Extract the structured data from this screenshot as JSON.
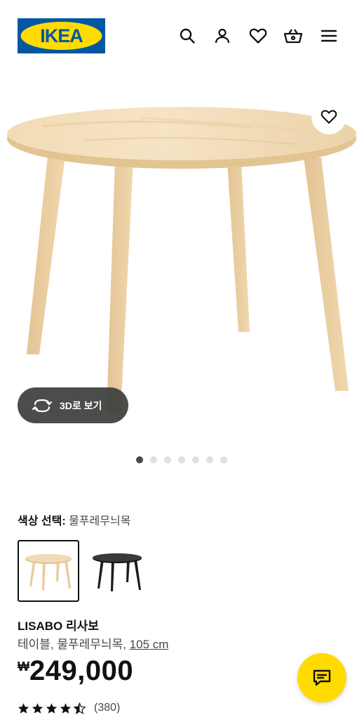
{
  "header": {
    "logo_text": "IKEA",
    "icons": [
      "search-icon",
      "account-icon",
      "heart-icon",
      "basket-icon",
      "menu-icon"
    ]
  },
  "gallery": {
    "button_3d_label": "3D로 보기",
    "slide_count": 7,
    "active_slide": 1
  },
  "product": {
    "color_label": "색상 선택:",
    "color_value": "물푸레무늬목",
    "swatches": [
      {
        "name": "물푸레무늬목",
        "selected": true
      },
      {
        "name": "black",
        "selected": false
      }
    ],
    "name": "LISABO 리사보",
    "desc_prefix": "테이블, 물푸레무늬목, ",
    "size_link": "105 cm",
    "currency": "₩",
    "price": "249,000",
    "rating_value": 4.5,
    "rating_max": 5,
    "review_count": "(380)"
  },
  "colors": {
    "ikea_blue": "#0058a3",
    "ikea_yellow": "#ffdb00",
    "dark": "#111111",
    "chip_bg": "#3c3e3c",
    "wood": "#ecd3a8"
  }
}
